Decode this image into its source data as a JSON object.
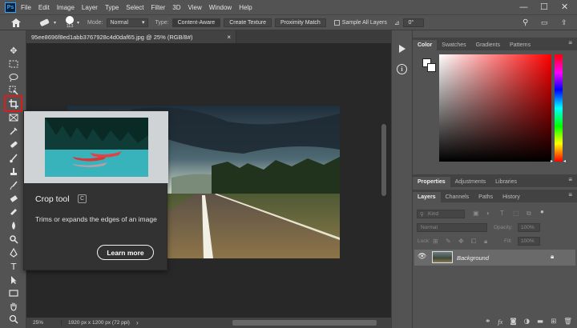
{
  "app": {
    "logo_text": "Ps",
    "menu": [
      "File",
      "Edit",
      "Image",
      "Layer",
      "Type",
      "Select",
      "Filter",
      "3D",
      "View",
      "Window",
      "Help"
    ],
    "window_controls": [
      "—",
      "☐",
      "✕"
    ]
  },
  "options_bar": {
    "brush_size": "113",
    "mode_label": "Mode:",
    "mode_value": "Normal",
    "type_label": "Type:",
    "type_buttons": [
      "Content-Aware",
      "Create Texture",
      "Proximity Match"
    ],
    "sample_all_layers": "Sample All Layers",
    "angle_value": "0°"
  },
  "document": {
    "tab_title": "95ee8696f8ed1abb3767928c4d0daf65.jpg @ 25% (RGB/8#)",
    "close_glyph": "×"
  },
  "status_bar": {
    "zoom": "25%",
    "dimensions": "1920 px x 1200 px (72 ppi)",
    "chevron": "›"
  },
  "tooltip": {
    "title": "Crop tool",
    "shortcut": "C",
    "description": "Trims or expands the edges of an image",
    "learn_more": "Learn more"
  },
  "color_panel": {
    "tabs": [
      "Color",
      "Swatches",
      "Gradients",
      "Patterns"
    ],
    "active_tab": "Color",
    "foreground": "#ffffff",
    "background": "#ffffff",
    "hue": "#ff0000"
  },
  "properties_panel": {
    "tabs": [
      "Properties",
      "Adjustments",
      "Libraries"
    ]
  },
  "layers_panel": {
    "tabs": [
      "Layers",
      "Channels",
      "Paths",
      "History"
    ],
    "filter_placeholder": "Kind",
    "blend_mode": "Normal",
    "opacity_label": "Opacity:",
    "opacity_value": "100%",
    "lock_label": "Lock:",
    "fill_label": "Fill:",
    "fill_value": "100%",
    "layers": [
      {
        "name": "Background",
        "visible": true,
        "locked": true
      }
    ],
    "footer_icons": [
      "link-icon",
      "fx-icon",
      "mask-icon",
      "adjustment-icon",
      "group-icon",
      "new-layer-icon",
      "trash-icon"
    ]
  },
  "colors": {
    "accent_highlight": "#e01b1b",
    "canvas_bg": "#282828",
    "panel_bg": "#535353"
  }
}
